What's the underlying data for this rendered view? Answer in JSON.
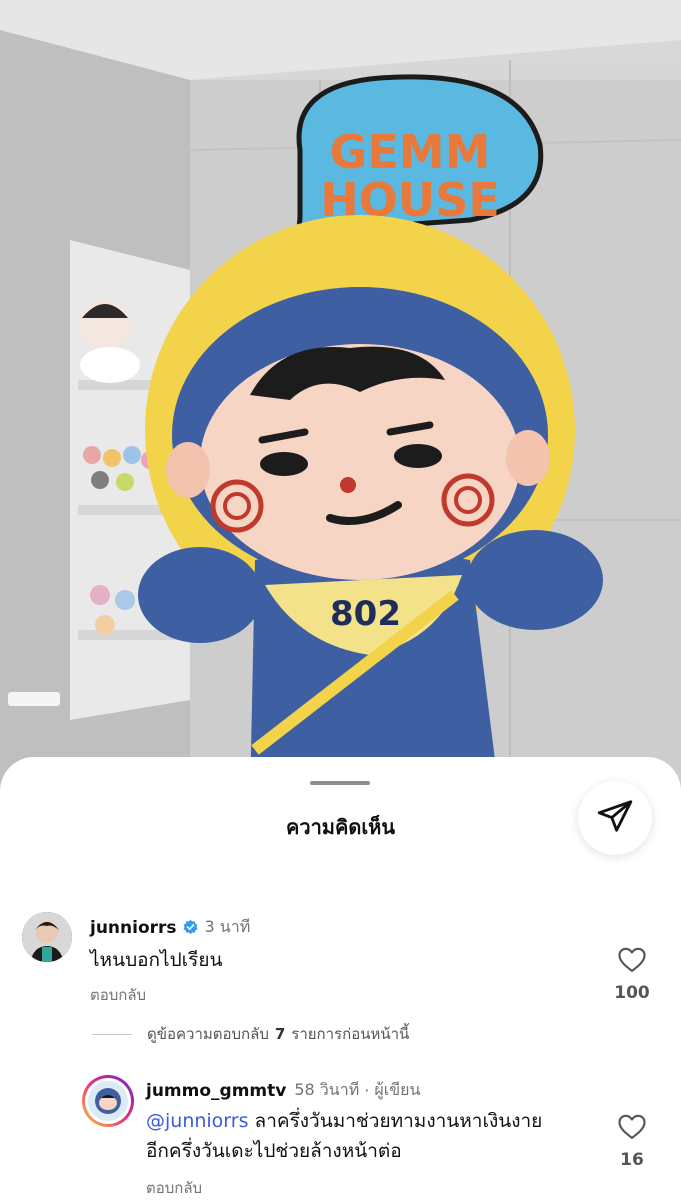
{
  "photo": {
    "sign_line1": "GEMM",
    "sign_line2": "HOUSE",
    "bib_number": "802"
  },
  "sheet": {
    "title": "ความคิดเห็น"
  },
  "comments": [
    {
      "username": "junniorrs",
      "verified": true,
      "time": "3 นาที",
      "text": "ไหนบอกไปเรียน",
      "reply_label": "ตอบกลับ",
      "likes": "100"
    },
    {
      "username": "jummo_gmmtv",
      "time": "58 วินาที",
      "separator": "·",
      "author_tag": "ผู้เขียน",
      "mention": "@junniorrs",
      "text_line1": "ลาครึ่งวันมาช่วยทามงานหาเงินงาย",
      "text_line2": "อีกครึ่งวันเดะไปช่วยล้างหน้าต่อ",
      "reply_label": "ตอบกลับ",
      "likes": "16"
    }
  ],
  "view_replies": {
    "prefix": "ดูข้อความตอบกลับ",
    "count": "7",
    "suffix": "รายการก่อนหน้านี้"
  },
  "icons": {
    "share": "paper-plane-icon",
    "like": "heart-outline-icon",
    "verified": "verified-badge-icon"
  },
  "colors": {
    "mention": "#3b5bdb",
    "verified": "#3897f0",
    "sign_bg": "#5bb8e0",
    "sign_text": "#e8793a",
    "mascot_blue": "#3f5fa3",
    "mascot_yellow": "#f3d34a"
  }
}
